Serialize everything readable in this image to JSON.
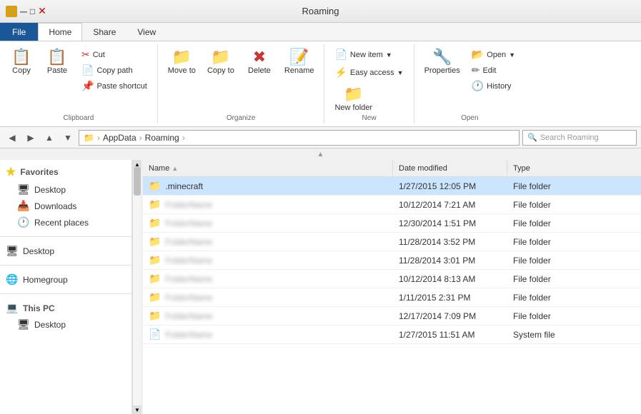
{
  "titleBar": {
    "title": "Roaming"
  },
  "ribbonTabs": {
    "tabs": [
      {
        "id": "file",
        "label": "File",
        "active": false,
        "isFile": true
      },
      {
        "id": "home",
        "label": "Home",
        "active": true,
        "isFile": false
      },
      {
        "id": "share",
        "label": "Share",
        "active": false,
        "isFile": false
      },
      {
        "id": "view",
        "label": "View",
        "active": false,
        "isFile": false
      }
    ]
  },
  "ribbon": {
    "groups": {
      "clipboard": {
        "label": "Clipboard",
        "copy": "Copy",
        "paste": "Paste",
        "cut": "Cut",
        "copyPath": "Copy path",
        "pasteShortcut": "Paste shortcut"
      },
      "organize": {
        "label": "Organize",
        "moveTo": "Move to",
        "copyTo": "Copy to",
        "delete": "Delete",
        "rename": "Rename"
      },
      "new": {
        "label": "New",
        "newItem": "New item",
        "easyAccess": "Easy access",
        "newFolder": "New folder"
      },
      "open": {
        "label": "Open",
        "properties": "Properties",
        "open": "Open",
        "edit": "Edit",
        "history": "History"
      }
    }
  },
  "addressBar": {
    "backTitle": "Back",
    "forwardTitle": "Forward",
    "upTitle": "Up",
    "paths": [
      {
        "label": "AppData"
      },
      {
        "label": "Roaming"
      }
    ],
    "searchPlaceholder": "Search Roaming"
  },
  "sortHint": {
    "arrow": "▲"
  },
  "sidebar": {
    "favorites": {
      "header": "Favorites",
      "items": [
        {
          "label": "Desktop",
          "icon": "🖥"
        },
        {
          "label": "Downloads",
          "icon": "📥"
        },
        {
          "label": "Recent places",
          "icon": "🕐"
        }
      ]
    },
    "desktop": {
      "label": "Desktop",
      "icon": "🖥"
    },
    "homegroup": {
      "label": "Homegroup",
      "icon": "🏠"
    },
    "thisPC": {
      "header": "This PC",
      "items": [
        {
          "label": "Desktop",
          "icon": "🖥"
        }
      ]
    }
  },
  "fileList": {
    "columns": {
      "name": "Name",
      "dateModified": "Date modified",
      "type": "Type"
    },
    "rows": [
      {
        "name": ".minecraft",
        "icon": "📁",
        "date": "1/27/2015 12:05 PM",
        "type": "File folder",
        "selected": true,
        "blurred": false
      },
      {
        "name": "blurred2",
        "icon": "📁",
        "date": "10/12/2014 7:21 AM",
        "type": "File folder",
        "selected": false,
        "blurred": true
      },
      {
        "name": "blurred3",
        "icon": "📁",
        "date": "12/30/2014 1:51 PM",
        "type": "File folder",
        "selected": false,
        "blurred": true
      },
      {
        "name": "blurred4",
        "icon": "📁",
        "date": "11/28/2014 3:52 PM",
        "type": "File folder",
        "selected": false,
        "blurred": true
      },
      {
        "name": "blurred5",
        "icon": "📁",
        "date": "11/28/2014 3:01 PM",
        "type": "File folder",
        "selected": false,
        "blurred": true
      },
      {
        "name": "blurred6",
        "icon": "📁",
        "date": "10/12/2014 8:13 AM",
        "type": "File folder",
        "selected": false,
        "blurred": true
      },
      {
        "name": "blurred7",
        "icon": "📁",
        "date": "1/11/2015 2:31 PM",
        "type": "File folder",
        "selected": false,
        "blurred": true
      },
      {
        "name": "blurred8",
        "icon": "📁",
        "date": "12/17/2014 7:09 PM",
        "type": "File folder",
        "selected": false,
        "blurred": true
      },
      {
        "name": "blurred9",
        "icon": "📄",
        "date": "1/27/2015 11:51 AM",
        "type": "System file",
        "selected": false,
        "blurred": true
      }
    ]
  }
}
